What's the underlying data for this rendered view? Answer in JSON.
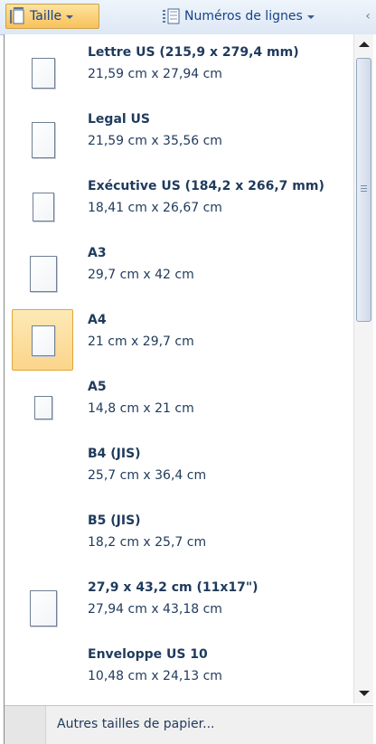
{
  "ribbon": {
    "size_button_label": "Taille",
    "line_numbers_label": "Numéros de lignes",
    "overflow_glyph": "‹",
    "size_icon": "page-size-icon",
    "line_numbers_icon": "line-numbers-icon"
  },
  "paper_sizes": [
    {
      "name": "Lettre US (215,9 x 279,4 mm)",
      "dimensions": "21,59 cm x 27,94 cm",
      "has_thumbnail": true,
      "selected": false
    },
    {
      "name": "Legal US",
      "dimensions": "21,59 cm x 35,56 cm",
      "has_thumbnail": true,
      "selected": false
    },
    {
      "name": "Exécutive US (184,2 x 266,7 mm)",
      "dimensions": "18,41 cm x 26,67 cm",
      "has_thumbnail": true,
      "selected": false
    },
    {
      "name": "A3",
      "dimensions": "29,7 cm x 42 cm",
      "has_thumbnail": true,
      "selected": false
    },
    {
      "name": "A4",
      "dimensions": "21 cm x 29,7 cm",
      "has_thumbnail": true,
      "selected": true
    },
    {
      "name": "A5",
      "dimensions": "14,8 cm x 21 cm",
      "has_thumbnail": true,
      "selected": false
    },
    {
      "name": "B4 (JIS)",
      "dimensions": "25,7 cm x 36,4 cm",
      "has_thumbnail": false,
      "selected": false
    },
    {
      "name": "B5 (JIS)",
      "dimensions": "18,2 cm x 25,7 cm",
      "has_thumbnail": false,
      "selected": false
    },
    {
      "name": "27,9 x 43,2 cm (11x17\")",
      "dimensions": "27,94 cm x 43,18 cm",
      "has_thumbnail": true,
      "selected": false
    },
    {
      "name": "Enveloppe US 10",
      "dimensions": "10,48 cm x 24,13 cm",
      "has_thumbnail": false,
      "selected": false
    }
  ],
  "footer": {
    "more_sizes_label": "Autres tailles de papier..."
  },
  "colors": {
    "selection_fill": "#fbd58a",
    "selection_border": "#e0a73b",
    "text": "#1f3a5c",
    "ribbon_text": "#15428b"
  }
}
